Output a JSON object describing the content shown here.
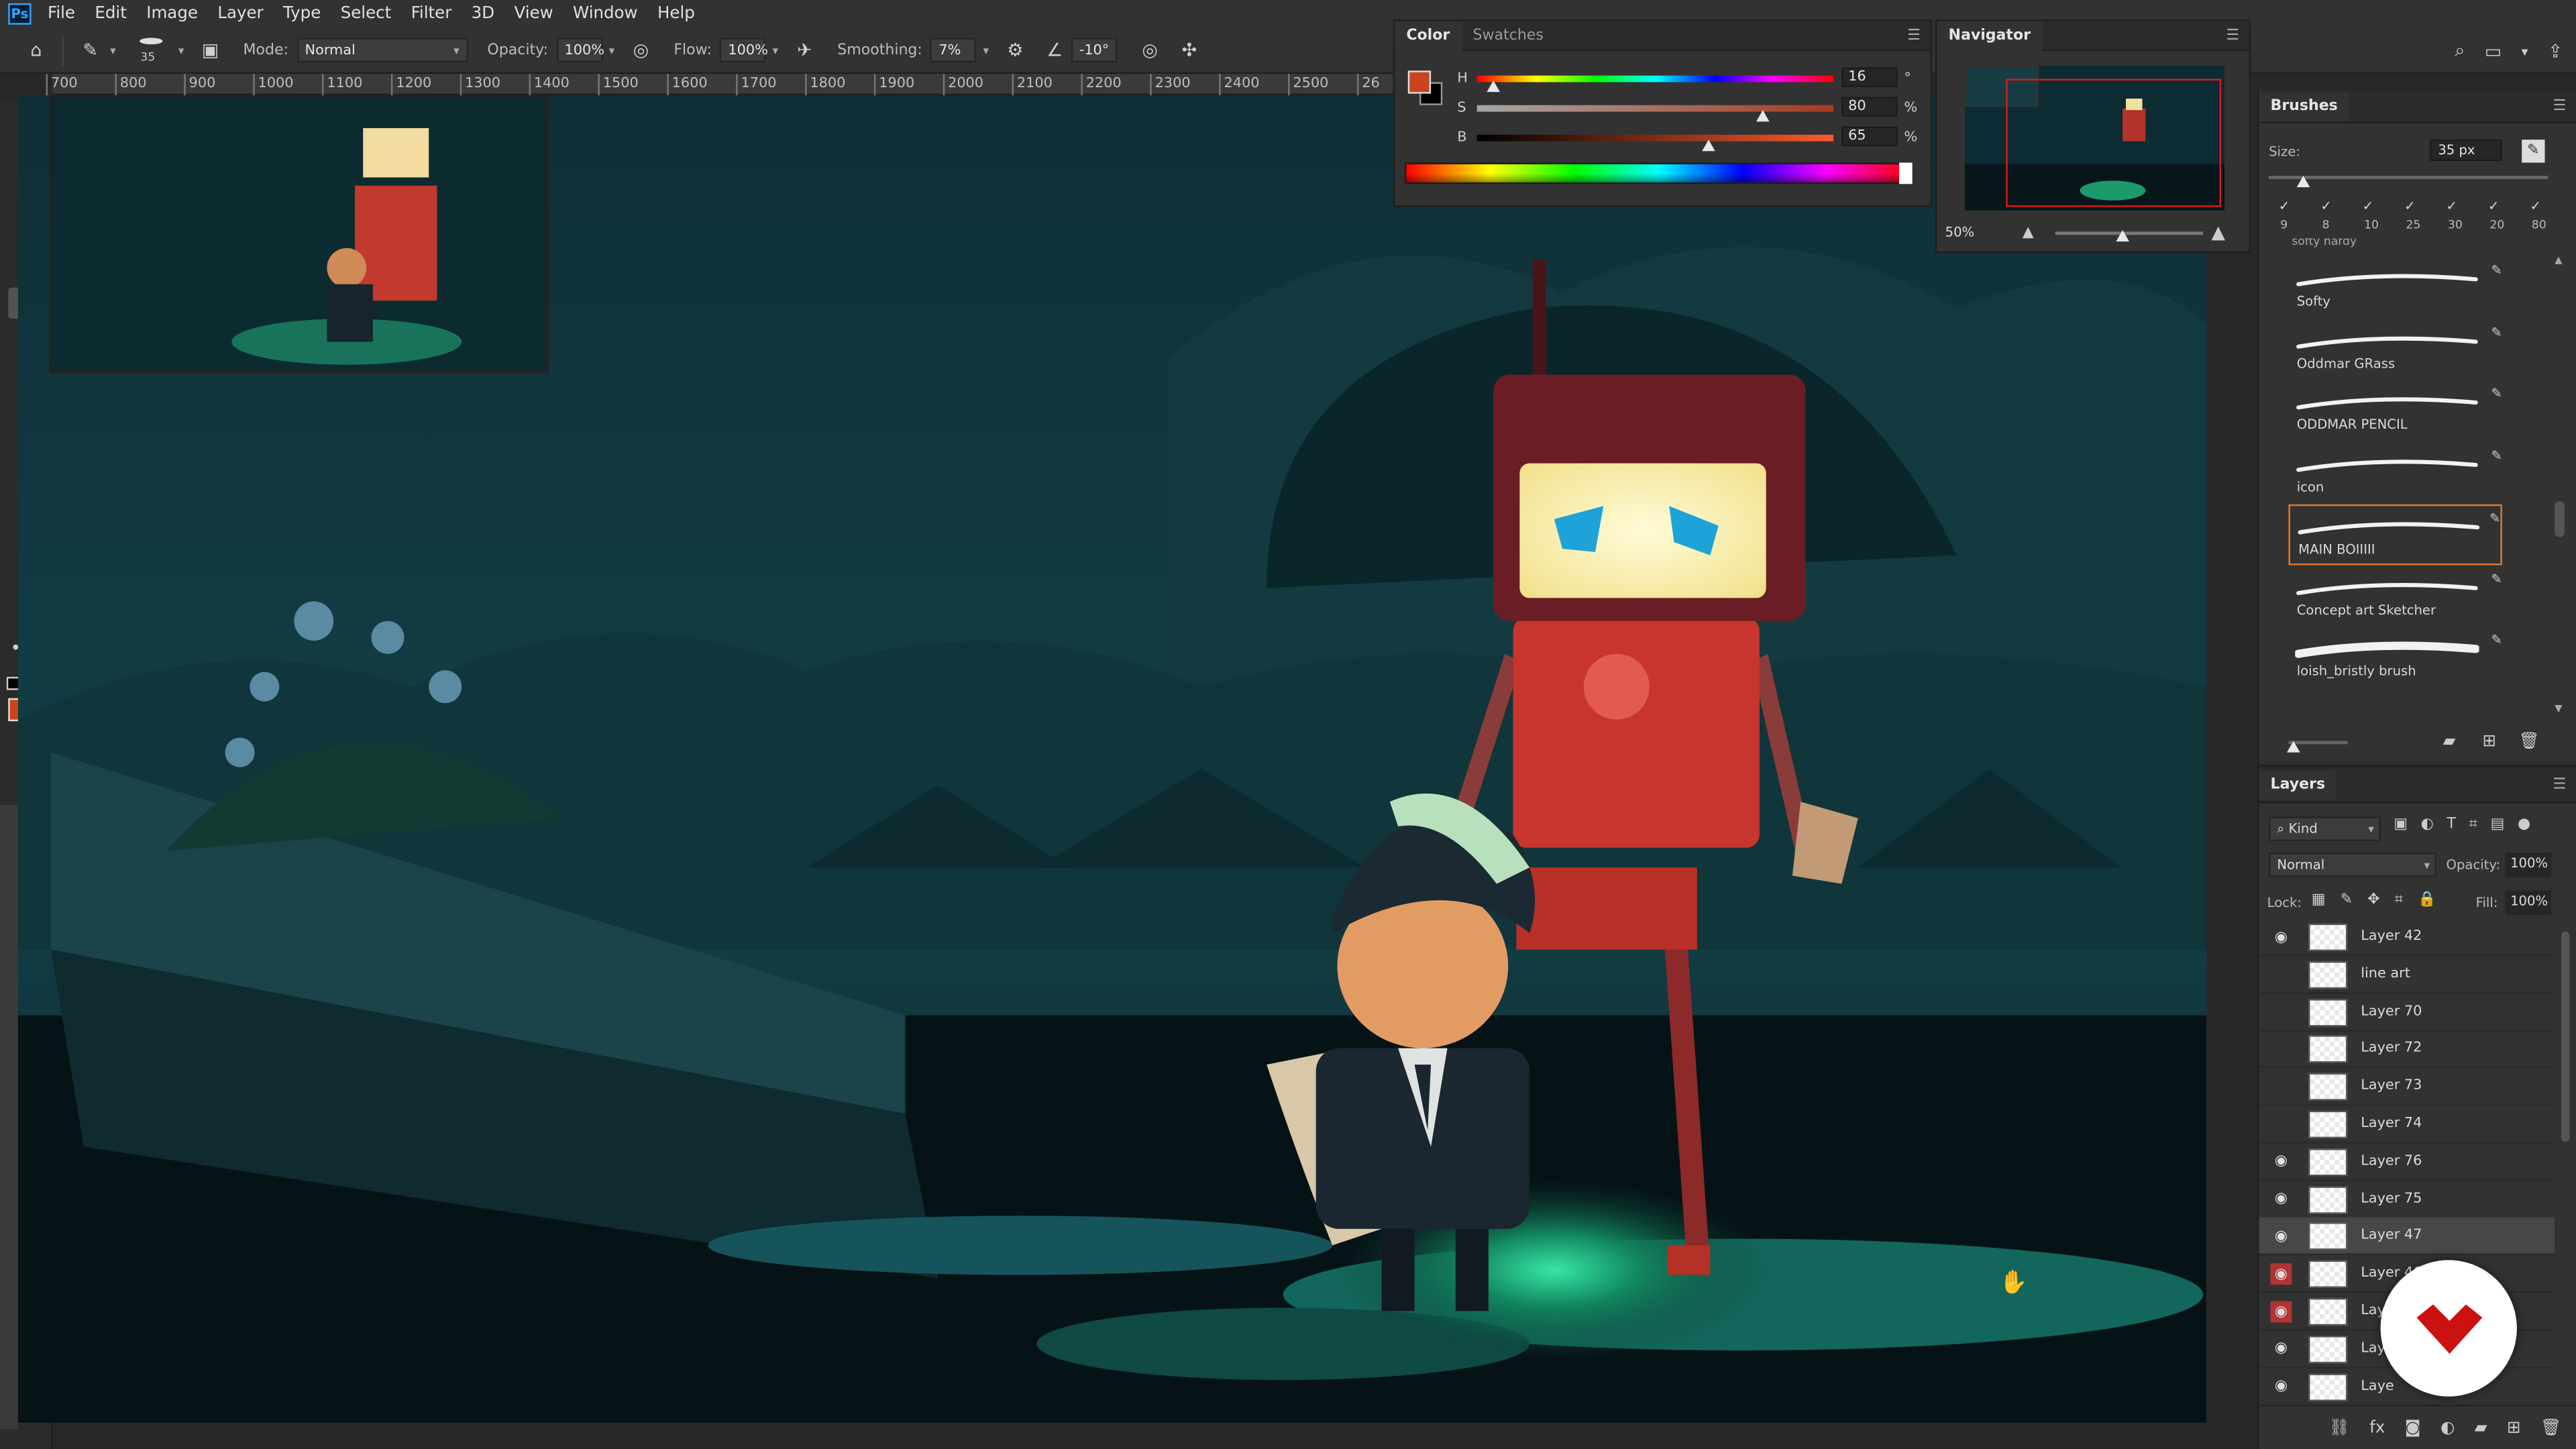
{
  "app": {
    "logo_text": "Ps"
  },
  "menu": [
    "File",
    "Edit",
    "Image",
    "Layer",
    "Type",
    "Select",
    "Filter",
    "3D",
    "View",
    "Window",
    "Help"
  ],
  "options": {
    "brush_size": "35",
    "mode_label": "Mode:",
    "mode_value": "Normal",
    "opacity_label": "Opacity:",
    "opacity_value": "100%",
    "flow_label": "Flow:",
    "flow_value": "100%",
    "smoothing_label": "Smoothing:",
    "smoothing_value": "7%",
    "angle_value": "-10°"
  },
  "ruler_labels": [
    "700",
    "800",
    "900",
    "1000",
    "1100",
    "1200",
    "1300",
    "1400",
    "1500",
    "1600",
    "1700",
    "1800",
    "1900",
    "2000",
    "2100",
    "2200",
    "2300",
    "2400",
    "2500",
    "26"
  ],
  "color_panel": {
    "tabs": [
      "Color",
      "Swatches"
    ],
    "active_tab": "Color",
    "foreground": "#c9441f",
    "hsb": [
      {
        "label": "H",
        "value": "16",
        "unit": "°",
        "fraction": 0.044
      },
      {
        "label": "S",
        "value": "80",
        "unit": "%",
        "fraction": 0.8
      },
      {
        "label": "B",
        "value": "65",
        "unit": "%",
        "fraction": 0.65
      }
    ]
  },
  "navigator": {
    "title": "Navigator",
    "zoom": "50%",
    "zoom_fraction": 0.45
  },
  "brushes": {
    "title": "Brushes",
    "size_label": "Size:",
    "size_value": "35 px",
    "size_fraction": 0.1,
    "presets": [
      "9",
      "8",
      "10",
      "25",
      "30",
      "20",
      "80"
    ],
    "truncated_label": "softy hardy",
    "items": [
      {
        "name": "Softy",
        "selected": false
      },
      {
        "name": "Oddmar GRass",
        "selected": false
      },
      {
        "name": "ODDMAR PENCIL",
        "selected": false
      },
      {
        "name": "icon",
        "selected": false
      },
      {
        "name": "MAIN BOIIIII",
        "selected": true
      },
      {
        "name": "Concept art Sketcher",
        "selected": false
      },
      {
        "name": "loish_bristly brush",
        "selected": false
      }
    ]
  },
  "layers": {
    "title": "Layers",
    "filter_label": "Kind",
    "blend_mode": "Normal",
    "opacity_label": "Opacity:",
    "opacity_value": "100%",
    "lock_label": "Lock:",
    "fill_label": "Fill:",
    "fill_value": "100%",
    "items": [
      {
        "name": "Layer 42",
        "visible": true,
        "selected": false,
        "red_eye": false
      },
      {
        "name": "line art",
        "visible": false,
        "selected": false,
        "red_eye": false
      },
      {
        "name": "Layer 70",
        "visible": false,
        "selected": false,
        "red_eye": false
      },
      {
        "name": "Layer 72",
        "visible": false,
        "selected": false,
        "red_eye": false
      },
      {
        "name": "Layer 73",
        "visible": false,
        "selected": false,
        "red_eye": false
      },
      {
        "name": "Layer 74",
        "visible": false,
        "selected": false,
        "red_eye": false
      },
      {
        "name": "Layer 76",
        "visible": true,
        "selected": false,
        "red_eye": false
      },
      {
        "name": "Layer 75",
        "visible": true,
        "selected": false,
        "red_eye": false
      },
      {
        "name": "Layer 47",
        "visible": true,
        "selected": true,
        "red_eye": false
      },
      {
        "name": "Layer 46",
        "visible": true,
        "selected": false,
        "red_eye": true
      },
      {
        "name": "Laye",
        "visible": true,
        "selected": false,
        "red_eye": true
      },
      {
        "name": "Laye",
        "visible": true,
        "selected": false,
        "red_eye": false
      },
      {
        "name": "Laye",
        "visible": true,
        "selected": false,
        "red_eye": false
      }
    ]
  },
  "colors": {
    "accent": "#e07a2e",
    "badge": "#cc1111"
  }
}
